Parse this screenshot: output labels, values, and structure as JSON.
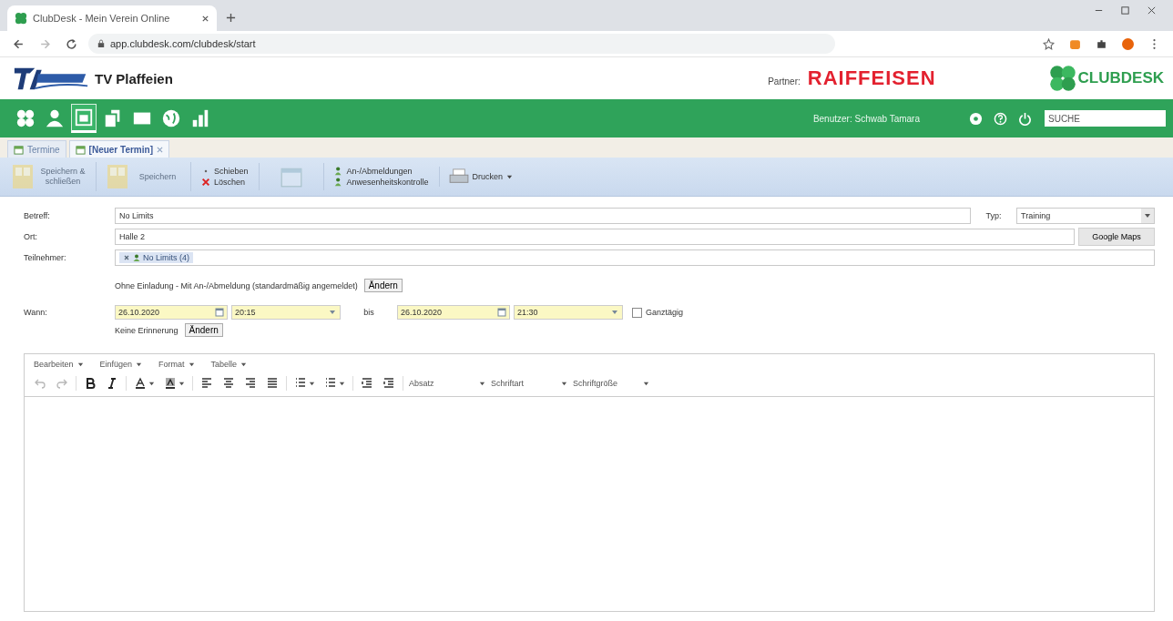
{
  "browser": {
    "tab_title": "ClubDesk - Mein Verein Online",
    "url": "app.clubdesk.com/clubdesk/start"
  },
  "header": {
    "club_name": "TV Plaffeien",
    "sponsor_label": "Partner:",
    "sponsor": "RAIFFEISEN",
    "brand": "CLUBDESK"
  },
  "nav": {
    "items": [
      {
        "kind": "clover",
        "selected": false
      },
      {
        "kind": "person",
        "selected": false
      },
      {
        "kind": "calendar",
        "selected": true
      },
      {
        "kind": "files",
        "selected": false
      },
      {
        "kind": "mail",
        "selected": false
      },
      {
        "kind": "globe",
        "selected": false
      },
      {
        "kind": "chart",
        "selected": false
      }
    ],
    "user": "Benutzer: Schwab Tamara",
    "search": {
      "placeholder": "SUCHE"
    }
  },
  "tabs": [
    {
      "label": "Termine",
      "selected": false,
      "closable": false
    },
    {
      "label": "[Neuer Termin]",
      "selected": true,
      "closable": true
    }
  ],
  "toolbar": [
    {
      "kind": "big",
      "label": "Speichern & schließen",
      "disabled": true
    },
    {
      "kind": "big",
      "label": "Speichern",
      "disabled": true
    },
    {
      "kind": "pair",
      "items": [
        {
          "label": "Schieben",
          "kind": "dot"
        },
        {
          "label": "Löschen",
          "kind": "cross"
        }
      ]
    },
    {
      "kind": "iconbig",
      "disabled": true
    },
    {
      "kind": "pair",
      "items": [
        {
          "label": "An-/Abmeldungen",
          "kind": "people"
        },
        {
          "label": "Anwesenheitskontrolle",
          "kind": "people"
        }
      ]
    },
    {
      "kind": "print",
      "label": "Drucken"
    }
  ],
  "form": {
    "subject_label": "Betreff:",
    "subject": "No Limits",
    "type_label": "Typ:",
    "type": "Training",
    "location_label": "Ort:",
    "location": "Halle 2",
    "maps_button": "Google Maps",
    "participants_label": "Teilnehmer:",
    "participant": "No Limits (4)",
    "invitation": "Ohne Einladung - Mit An-/Abmeldung (standardmäßig angemeldet)",
    "invitation_button": "Ändern",
    "when_label": "Wann:",
    "start_date": "26.10.2020",
    "start_time": "20:15",
    "until": "bis",
    "end_date": "26.10.2020",
    "end_time": "21:30",
    "all_day": {
      "label": "Ganztägig",
      "checked": false
    },
    "reminder": "Keine Erinnerung",
    "reminder_button": "Ändern"
  },
  "editor": {
    "menus": [
      "Bearbeiten",
      "Einfügen",
      "Format",
      "Tabelle"
    ],
    "tools": [
      {
        "kind": "undo",
        "disabled": true
      },
      {
        "kind": "redo",
        "disabled": true
      },
      {
        "kind": "sep"
      },
      {
        "kind": "bold"
      },
      {
        "kind": "italic"
      },
      {
        "kind": "sep"
      },
      {
        "kind": "fontcolor"
      },
      {
        "kind": "bgcolor"
      },
      {
        "kind": "sep"
      },
      {
        "kind": "alignleft"
      },
      {
        "kind": "aligncenter"
      },
      {
        "kind": "alignright"
      },
      {
        "kind": "justify"
      },
      {
        "kind": "sep"
      },
      {
        "kind": "bullets"
      },
      {
        "kind": "numbers"
      },
      {
        "kind": "sep"
      },
      {
        "kind": "outdent"
      },
      {
        "kind": "indent"
      },
      {
        "kind": "sep"
      }
    ],
    "dropdowns": [
      "Absatz",
      "Schriftart",
      "Schriftgröße"
    ]
  }
}
